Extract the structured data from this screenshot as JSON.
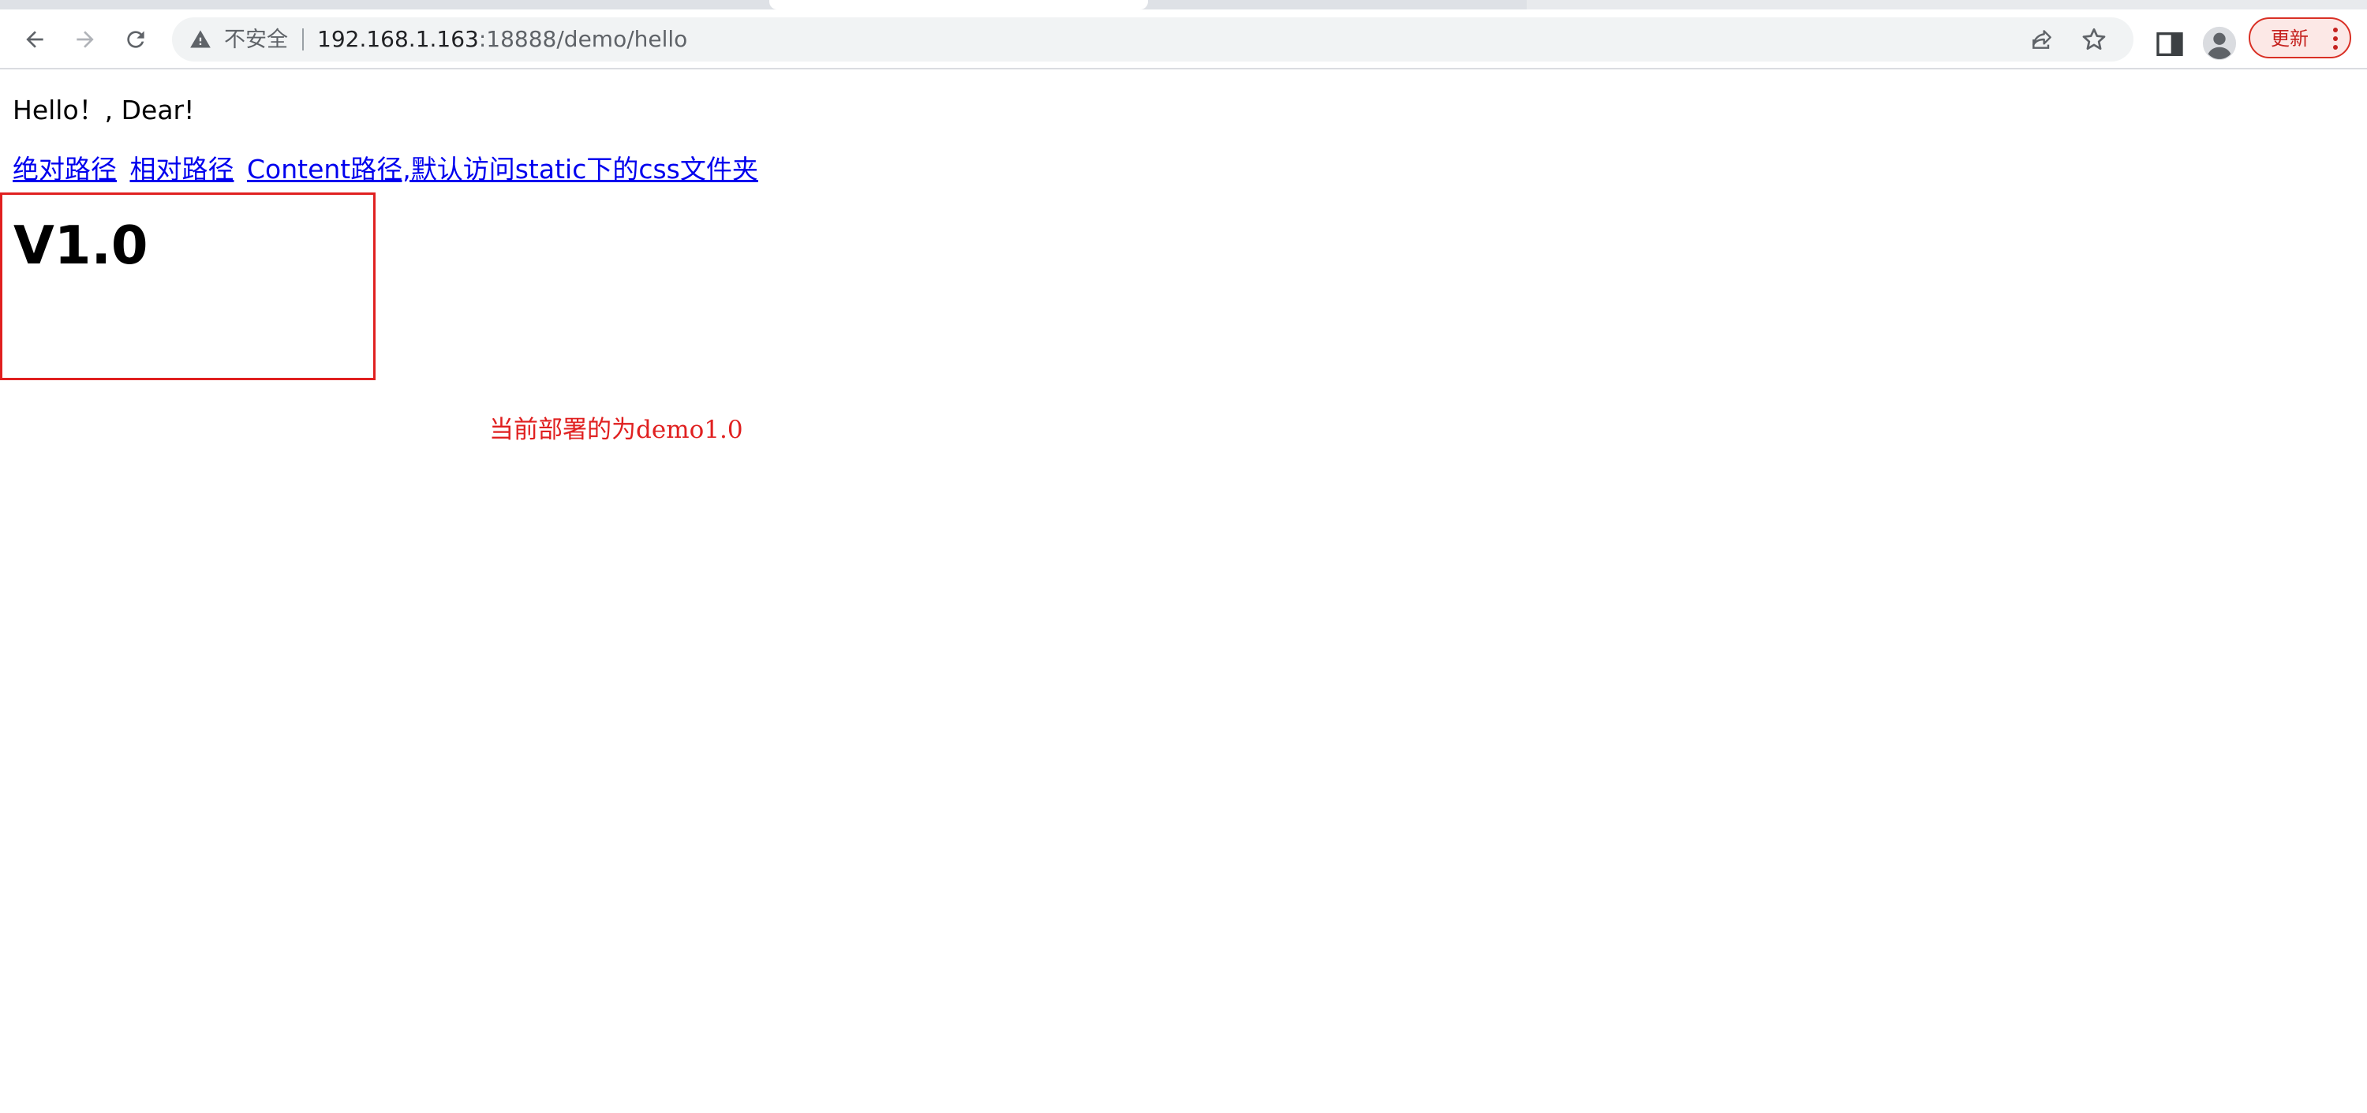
{
  "browser": {
    "security_label": "不安全",
    "url_host": "192.168.1.163",
    "url_rest": ":18888/demo/hello",
    "update_label": "更新",
    "icons": {
      "back": "arrow-left",
      "forward": "arrow-right",
      "reload": "refresh",
      "warning": "warning-triangle",
      "share": "share",
      "bookmark": "star",
      "side_panel": "side-panel",
      "profile": "person",
      "menu": "vertical-dots"
    },
    "colors": {
      "update_accent": "#d93025",
      "link": "#0000ee",
      "highlight": "#e02020"
    }
  },
  "page": {
    "greeting": "Hello！, Dear!",
    "links": [
      {
        "label": "绝对路径"
      },
      {
        "label": "相对路径"
      },
      {
        "label": "Content路径,默认访问static下的css文件夹"
      }
    ],
    "version": "V1.0",
    "deploy_note": "当前部署的为demo1.0"
  }
}
